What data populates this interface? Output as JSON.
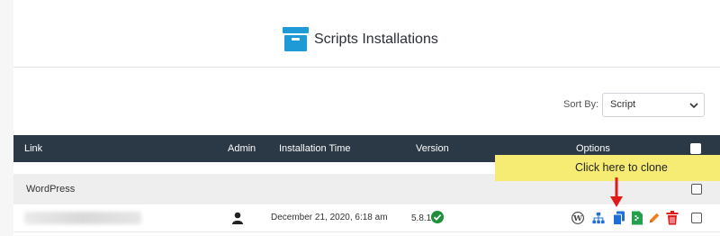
{
  "page": {
    "title": "Scripts Installations",
    "title_icon": "archive-box-icon",
    "accent": "#1e9bd7"
  },
  "sort": {
    "label": "Sort By:",
    "selected": "Script"
  },
  "table": {
    "headers": {
      "link": "Link",
      "admin": "Admin",
      "installation_time": "Installation Time",
      "version": "Version",
      "options": "Options"
    },
    "group": {
      "label": "WordPress"
    },
    "rows": [
      {
        "admin_icon": "user-icon",
        "installation_time": "December 21, 2020, 6:18 am",
        "version": "5.8.1",
        "version_status": "check-circle-icon",
        "options": [
          "wordpress-icon",
          "sitemap-icon",
          "clone-icon",
          "backup-icon",
          "edit-icon",
          "delete-icon"
        ]
      }
    ]
  },
  "tooltip": {
    "text": "Click here to clone",
    "color": "#f7ec73",
    "arrow_color": "#e11919"
  }
}
